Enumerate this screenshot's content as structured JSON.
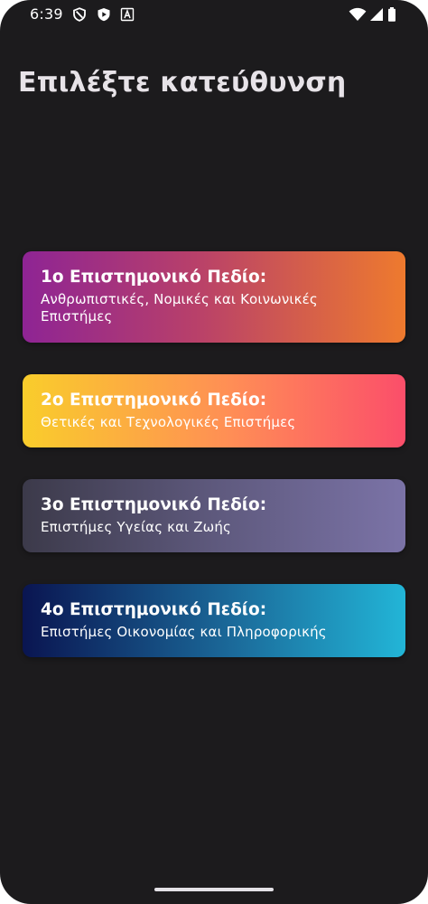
{
  "status_bar": {
    "time": "6:39",
    "left_icons": [
      "shield-icon",
      "play-protect-icon",
      "font-a-icon"
    ],
    "right_icons": [
      "wifi-icon",
      "signal-icon",
      "battery-icon"
    ]
  },
  "header": {
    "title": "Επιλέξτε κατεύθυνση"
  },
  "cards": [
    {
      "title": "1ο Επιστημονικό Πεδίο:",
      "subtitle": "Ανθρωπιστικές, Νομικές και Κοινωνικές Επιστήμες",
      "gradient": [
        "#8e2494",
        "#ee7a2e"
      ]
    },
    {
      "title": "2ο Επιστημονικό Πεδίο:",
      "subtitle": "Θετικές και Τεχνολογικές Επιστήμες",
      "gradient": [
        "#f9cd2b",
        "#ff8d56",
        "#fb4e6a"
      ]
    },
    {
      "title": "3ο Επιστημονικό Πεδίο:",
      "subtitle": "Επιστήμες Υγείας και Ζωής",
      "gradient": [
        "#3c3a4a",
        "#7b73a7"
      ]
    },
    {
      "title": "4ο Επιστημονικό Πεδίο:",
      "subtitle": "Επιστήμες Οικονομίας και Πληροφορικής",
      "gradient": [
        "#0a1551",
        "#1b6a9a",
        "#22b5d7"
      ]
    }
  ],
  "colors": {
    "background": "#1c1b1d",
    "title_text": "#e7e3e8",
    "card_text": "#ffffff"
  }
}
